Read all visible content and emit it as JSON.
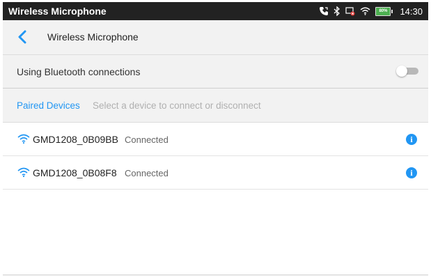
{
  "status_bar": {
    "title": "Wireless Microphone",
    "battery_level": "80%",
    "time": "14:30",
    "icons": [
      "call-forward-icon",
      "bluetooth-icon",
      "screen-error-icon",
      "wifi-icon",
      "battery-icon"
    ]
  },
  "app_bar": {
    "back_icon": "chevron-left-icon",
    "title": "Wireless Microphone"
  },
  "bluetooth_setting": {
    "label": "Using Bluetooth connections",
    "toggle_state": "off"
  },
  "paired_section": {
    "tab_label": "Paired Devices",
    "hint": "Select a device to connect or disconnect"
  },
  "devices": [
    {
      "name": "GMD1208_0B09BB",
      "status": "Connected",
      "icon": "wifi-signal-icon",
      "action_icon": "info-icon"
    },
    {
      "name": "GMD1208_0B08F8",
      "status": "Connected",
      "icon": "wifi-signal-icon",
      "action_icon": "info-icon"
    }
  ],
  "colors": {
    "accent": "#2196f3",
    "status_bar_bg": "#222222",
    "battery": "#4caf50",
    "panel_bg": "#f2f2f2"
  }
}
